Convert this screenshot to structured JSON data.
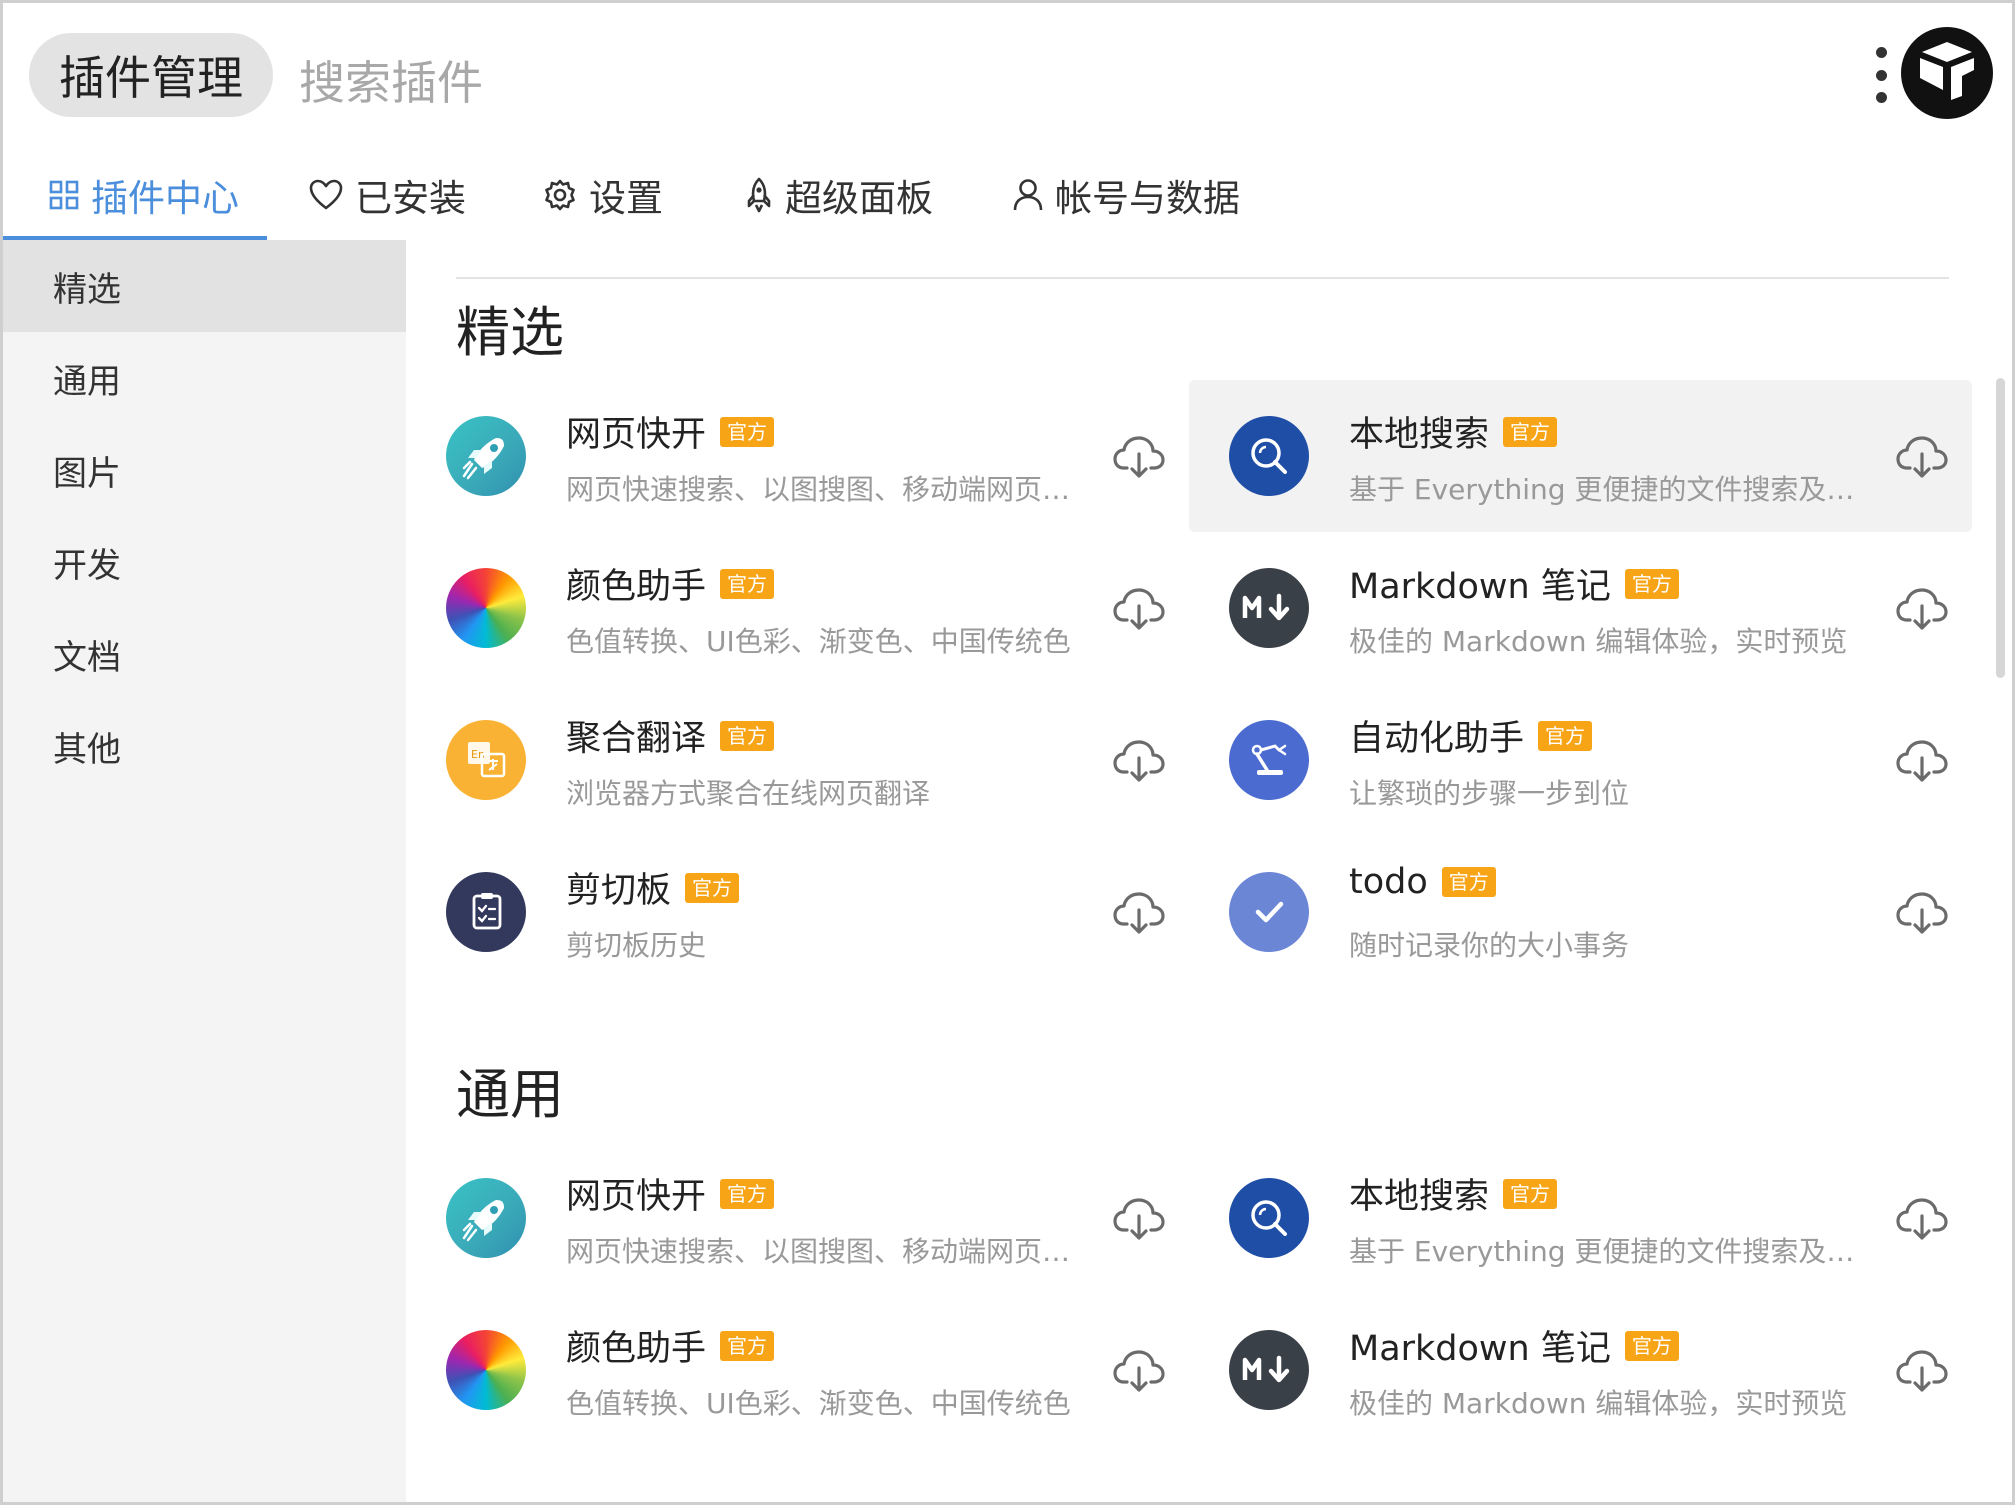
{
  "header": {
    "title": "插件管理",
    "search_placeholder": "搜索插件"
  },
  "tabs": [
    {
      "label": "插件中心",
      "icon": "grid-icon",
      "active": true
    },
    {
      "label": "已安装",
      "icon": "heart-icon"
    },
    {
      "label": "设置",
      "icon": "gear-icon"
    },
    {
      "label": "超级面板",
      "icon": "rocket-icon"
    },
    {
      "label": "帐号与数据",
      "icon": "user-icon"
    }
  ],
  "sidebar": {
    "items": [
      {
        "label": "精选",
        "active": true
      },
      {
        "label": "通用"
      },
      {
        "label": "图片"
      },
      {
        "label": "开发"
      },
      {
        "label": "文档"
      },
      {
        "label": "其他"
      }
    ]
  },
  "badge_label": "官方",
  "sections": [
    {
      "title": "精选",
      "plugins": [
        {
          "name": "网页快开",
          "desc": "网页快速搜索、以图搜图、移动端网页打开",
          "icon": "rocket-icon"
        },
        {
          "name": "本地搜索",
          "desc": "基于 Everything 更便捷的文件搜索及快速打开",
          "icon": "search-icon"
        },
        {
          "name": "颜色助手",
          "desc": "色值转换、UI色彩、渐变色、中国传统色",
          "icon": "color-wheel-icon"
        },
        {
          "name": "Markdown 笔记",
          "desc": "极佳的 Markdown 编辑体验，实时预览",
          "icon": "markdown-icon"
        },
        {
          "name": "聚合翻译",
          "desc": "浏览器方式聚合在线网页翻译",
          "icon": "translate-icon"
        },
        {
          "name": "自动化助手",
          "desc": "让繁琐的步骤一步到位",
          "icon": "robot-arm-icon"
        },
        {
          "name": "剪切板",
          "desc": "剪切板历史",
          "icon": "clipboard-icon"
        },
        {
          "name": "todo",
          "desc": "随时记录你的大小事务",
          "icon": "check-icon"
        }
      ]
    },
    {
      "title": "通用",
      "plugins": [
        {
          "name": "网页快开",
          "desc": "网页快速搜索、以图搜图、移动端网页打开",
          "icon": "rocket-icon"
        },
        {
          "name": "本地搜索",
          "desc": "基于 Everything 更便捷的文件搜索及快速打开",
          "icon": "search-icon"
        },
        {
          "name": "颜色助手",
          "desc": "色值转换、UI色彩、渐变色、中国传统色",
          "icon": "color-wheel-icon"
        },
        {
          "name": "Markdown 笔记",
          "desc": "极佳的 Markdown 编辑体验，实时预览",
          "icon": "markdown-icon"
        }
      ]
    }
  ],
  "colors": {
    "accent": "#4a8edc",
    "badge": "#f7a417",
    "sidebar_bg": "#f4f4f4",
    "sidebar_active": "#e2e2e2"
  }
}
